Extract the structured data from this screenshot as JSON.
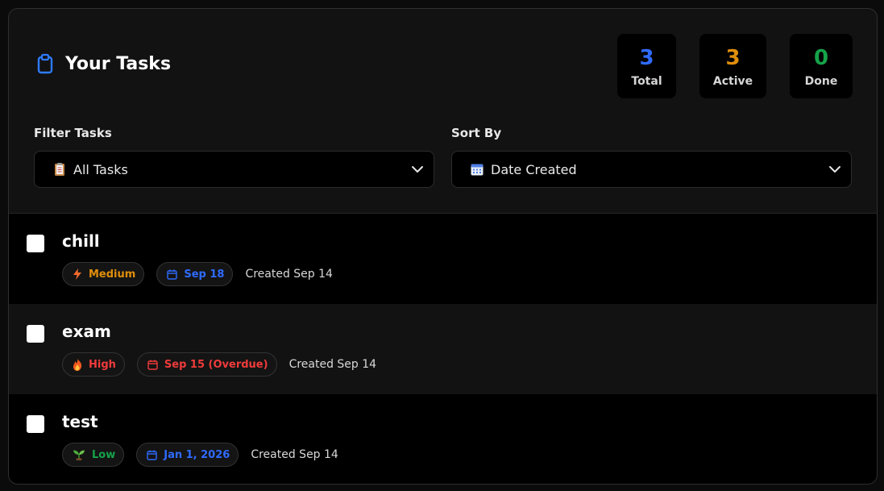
{
  "header": {
    "title": "Your Tasks",
    "icon": "clipboard-icon"
  },
  "stats": [
    {
      "value": "3",
      "label": "Total",
      "color": "#2f6bff"
    },
    {
      "value": "3",
      "label": "Active",
      "color": "#e08e0b"
    },
    {
      "value": "0",
      "label": "Done",
      "color": "#16a34a"
    }
  ],
  "filter": {
    "label": "Filter Tasks",
    "value": "All Tasks",
    "icon": "clipboard-emoji-icon"
  },
  "sort": {
    "label": "Sort By",
    "value": "Date Created",
    "icon": "calendar-emoji-icon"
  },
  "tasks": [
    {
      "title": "chill",
      "priority": "Medium",
      "priority_icon": "lightning-icon",
      "priority_color": "#e08e0b",
      "due": "Sep 18",
      "due_color": "#2f6bff",
      "created": "Created Sep 14"
    },
    {
      "title": "exam",
      "priority": "High",
      "priority_icon": "fire-icon",
      "priority_color": "#ef3b3b",
      "due": "Sep 15 (Overdue)",
      "due_color": "#ef3b3b",
      "created": "Created Sep 14"
    },
    {
      "title": "test",
      "priority": "Low",
      "priority_icon": "seedling-icon",
      "priority_color": "#16a34a",
      "due": "Jan 1, 2026",
      "due_color": "#2f6bff",
      "created": "Created Sep 14"
    }
  ]
}
